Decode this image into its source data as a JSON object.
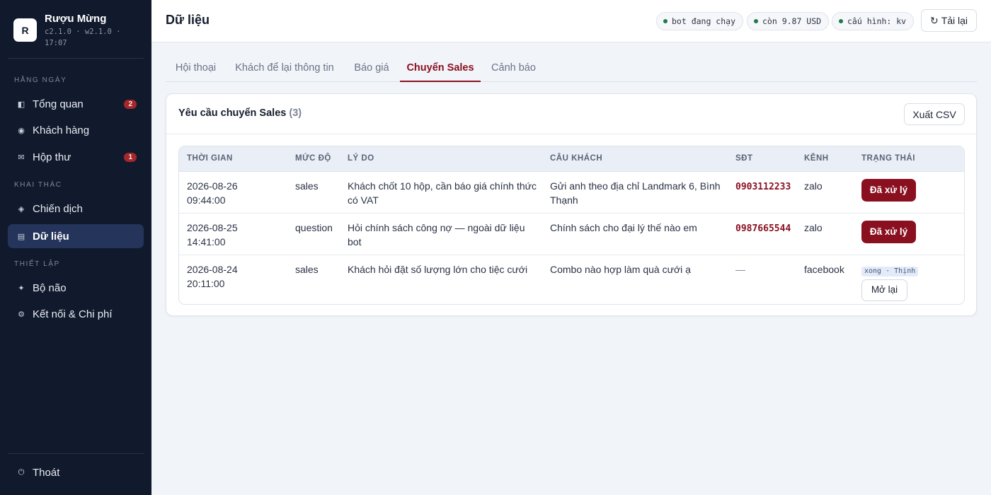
{
  "brand": {
    "logo_letter": "R",
    "name": "Rượu Mừng",
    "version": "c2.1.0 · w2.1.0 · 17:07"
  },
  "sidebar": {
    "sections": [
      {
        "label": "HẰNG NGÀY"
      },
      {
        "label": "KHAI THÁC"
      },
      {
        "label": "THIẾT LẬP"
      }
    ],
    "items": [
      {
        "label": "Tổng quan",
        "icon": "dashboard-icon",
        "badge": "2"
      },
      {
        "label": "Khách hàng",
        "icon": "customers-icon"
      },
      {
        "label": "Hộp thư",
        "icon": "mail-icon",
        "badge": "1"
      },
      {
        "label": "Chiến dịch",
        "icon": "campaign-icon"
      },
      {
        "label": "Dữ liệu",
        "icon": "data-icon",
        "active": true
      },
      {
        "label": "Bộ não",
        "icon": "brain-icon"
      },
      {
        "label": "Kết nối & Chi phí",
        "icon": "settings-icon"
      }
    ],
    "logout_label": "Thoát"
  },
  "header": {
    "title": "Dữ liệu",
    "status": [
      "bot đang chạy",
      "còn 9.87 USD",
      "cấu hình: kv"
    ],
    "status_color": "#1f7a47",
    "reload_label": "Tải lại"
  },
  "tabs": [
    {
      "label": "Hội thoại"
    },
    {
      "label": "Khách để lại thông tin"
    },
    {
      "label": "Báo giá"
    },
    {
      "label": "Chuyển Sales",
      "active": true
    },
    {
      "label": "Cảnh báo"
    }
  ],
  "card": {
    "title": "Yêu cầu chuyển Sales",
    "count": "(3)",
    "export_label": "Xuất CSV"
  },
  "table": {
    "headers": [
      "THỜI GIAN",
      "MỨC ĐỘ",
      "LÝ DO",
      "CÂU KHÁCH",
      "SĐT",
      "KÊNH",
      "TRẠNG THÁI"
    ],
    "rows": [
      {
        "date": "2026-08-26",
        "time": "09:44:00",
        "level": "sales",
        "reason": "Khách chốt 10 hộp, cần báo giá chính thức có VAT",
        "message": "Gửi anh theo địa chỉ Landmark 6, Bình Thạnh",
        "phone": "0903112233",
        "channel": "zalo",
        "status_label": "Đã xử lý"
      },
      {
        "date": "2026-08-25",
        "time": "14:41:00",
        "level": "question",
        "reason": "Hỏi chính sách công nợ — ngoài dữ liệu bot",
        "message": "Chính sách cho đại lý thế nào em",
        "phone": "0987665544",
        "channel": "zalo",
        "status_label": "Đã xử lý"
      },
      {
        "date": "2026-08-24",
        "time": "20:11:00",
        "level": "sales",
        "reason": "Khách hỏi đặt số lượng lớn cho tiệc cưới",
        "message": "Combo nào hợp làm quà cưới ạ",
        "phone": "—",
        "channel": "facebook",
        "status_tag": "xong · Thịnh",
        "reopen_label": "Mở lại"
      }
    ]
  },
  "colors": {
    "accent": "#8a1020",
    "sidebar_bg": "#111a2c",
    "active_nav": "#24345a"
  }
}
